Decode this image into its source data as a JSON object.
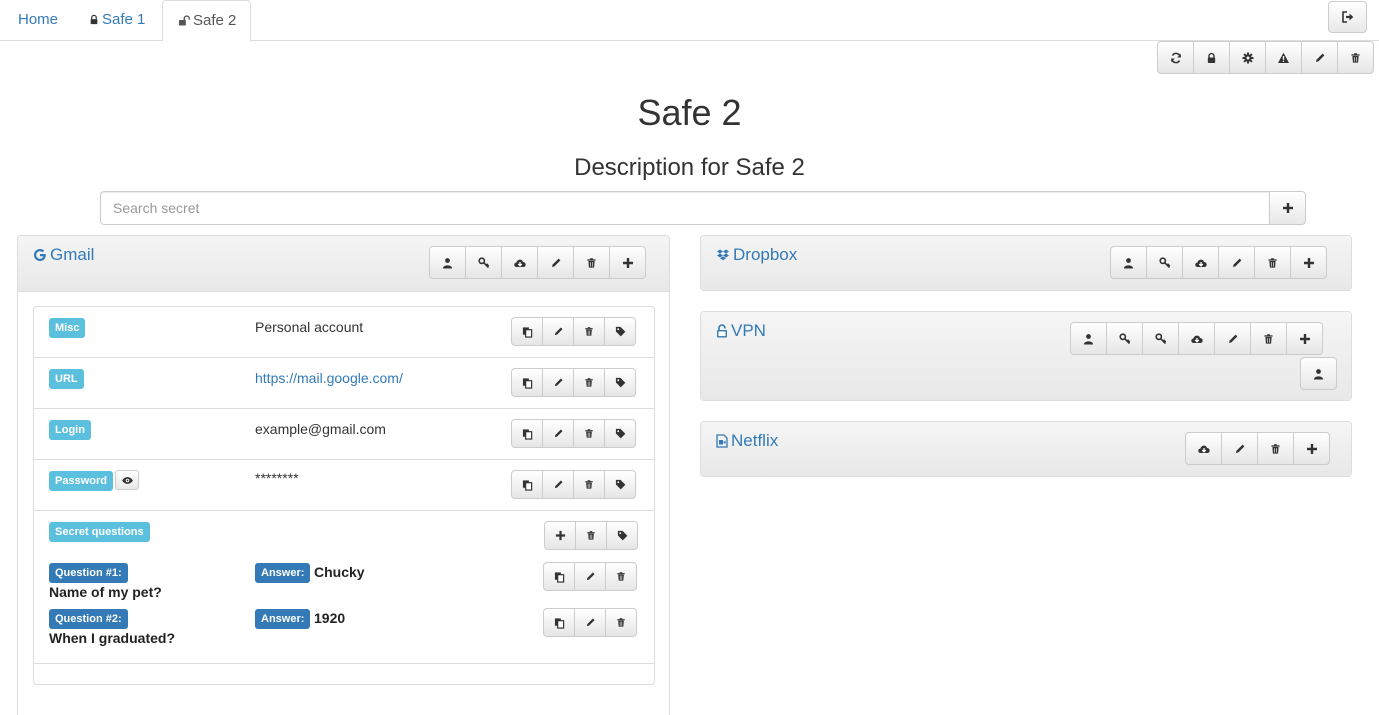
{
  "tabs": [
    {
      "label": "Home",
      "icon": "none"
    },
    {
      "label": "Safe 1",
      "icon": "lock-icon"
    },
    {
      "label": "Safe 2",
      "icon": "unlock-icon"
    }
  ],
  "toolbar": [
    "refresh-icon",
    "lock-icon",
    "gear-icon",
    "warning-icon",
    "pencil-icon",
    "trash-icon"
  ],
  "page": {
    "title": "Safe 2",
    "description": "Description for Safe 2"
  },
  "search": {
    "placeholder": "Search secret"
  },
  "secrets": {
    "gmail": {
      "title": "Gmail",
      "fields": [
        {
          "label": "Misc",
          "value": "Personal account"
        },
        {
          "label": "URL",
          "value": "https://mail.google.com/"
        },
        {
          "label": "Login",
          "value": "example@gmail.com"
        },
        {
          "label": "Password",
          "value": "********"
        }
      ],
      "secret_questions": {
        "label": "Secret questions",
        "items": [
          {
            "question_label": "Question #1:",
            "question": "Name of my pet?",
            "answer_label": "Answer:",
            "answer": "Chucky"
          },
          {
            "question_label": "Question #2:",
            "question": "When I graduated?",
            "answer_label": "Answer:",
            "answer": "1920"
          }
        ]
      }
    },
    "dropbox": {
      "title": "Dropbox"
    },
    "vpn": {
      "title": "VPN"
    },
    "netflix": {
      "title": "Netflix"
    }
  },
  "colors": {
    "link": "#337ab7",
    "label_info": "#5bc0de",
    "label_primary": "#337ab7"
  }
}
